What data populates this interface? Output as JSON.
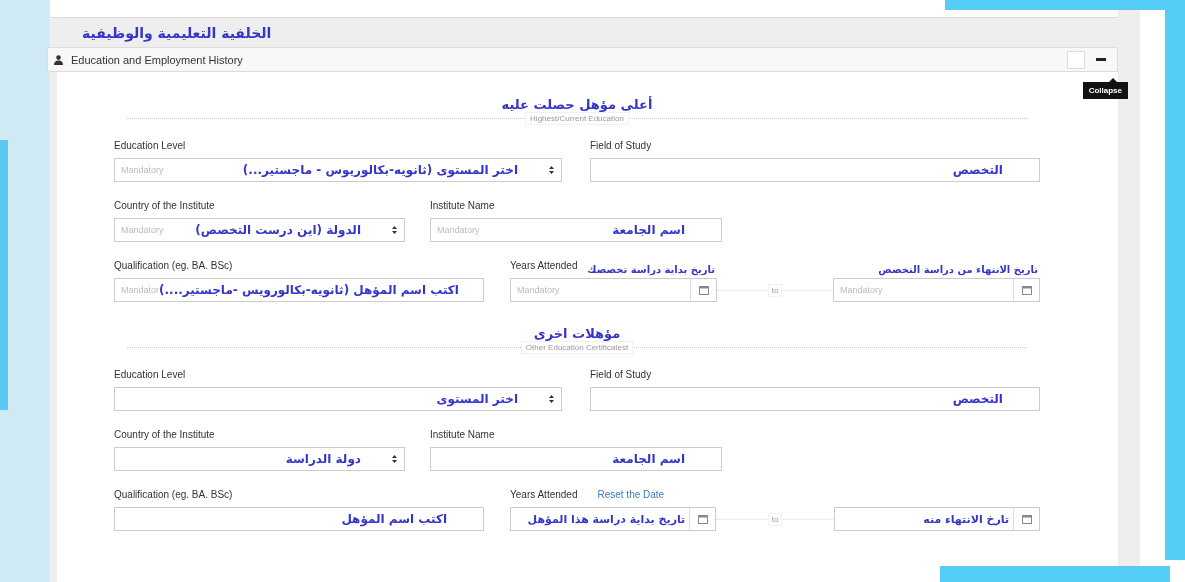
{
  "page_note": "الخلفية التعليمية والوظيفية",
  "panel": {
    "title": "Education and Employment History",
    "tooltip": "Collapse"
  },
  "sections": [
    {
      "note": "أعلى مؤهل حصلت عليه",
      "heading": "Highest/Current Education",
      "rows": [
        {
          "kind": "pair",
          "left": {
            "label": "Education Level",
            "kind": "select",
            "placeholder": "Mandatory",
            "note": "اختر المستوى (ثانويه-بكالوريوس - ماجستير...)"
          },
          "right": {
            "label": "Field of Study",
            "kind": "text",
            "note": "التخصص"
          }
        },
        {
          "kind": "trio",
          "left": {
            "label": "Country of the Institute",
            "kind": "select",
            "placeholder": "Mandatory",
            "note": "الدولة (اين درست التخصص)"
          },
          "right": {
            "label": "Institute Name",
            "kind": "text",
            "placeholder": "Mandatory",
            "note": "اسم الجامعة"
          }
        },
        {
          "kind": "dates",
          "left": {
            "label": "Qualification (eg. BA. BSc)",
            "kind": "text",
            "placeholder": "Mandator",
            "note": "اكتب اسم المؤهل (ثانويه-بكالورويس -ماجستير....)"
          },
          "start": {
            "label": "Years Attended",
            "kind": "date",
            "placeholder": "Mandatory",
            "note": "تاريخ بداية دراسة تخصصك",
            "note_raised": true
          },
          "end": {
            "label": "to",
            "kind": "date",
            "placeholder": "Mandatory",
            "note": "تاريخ الانتهاء من دراسة التخصص",
            "note_raised": true
          }
        }
      ]
    },
    {
      "note": "مؤهلات اخرى",
      "heading": "Other Education Certificatest",
      "rows": [
        {
          "kind": "pair",
          "left": {
            "label": "Education Level",
            "kind": "select",
            "note": "اختر المستوى"
          },
          "right": {
            "label": "Field of Study",
            "kind": "text",
            "note": "التخصص"
          }
        },
        {
          "kind": "trio",
          "left": {
            "label": "Country of the Institute",
            "kind": "select",
            "note": "دولة الدراسة"
          },
          "right": {
            "label": "Institute Name",
            "kind": "text",
            "note": "اسم الجامعة"
          }
        },
        {
          "kind": "dates",
          "link": "Reset the Date",
          "left": {
            "label": "Qualification (eg. BA. BSc)",
            "kind": "text",
            "note": "اكتب اسم المؤهل"
          },
          "start": {
            "label": "Years Attended",
            "kind": "date",
            "note": "تاريخ بداية دراسة هذا المؤهل",
            "note_raised": false
          },
          "end": {
            "label": "to",
            "kind": "date",
            "note": "تارخ الانتهاء منه",
            "note_raised": false
          }
        }
      ]
    }
  ]
}
